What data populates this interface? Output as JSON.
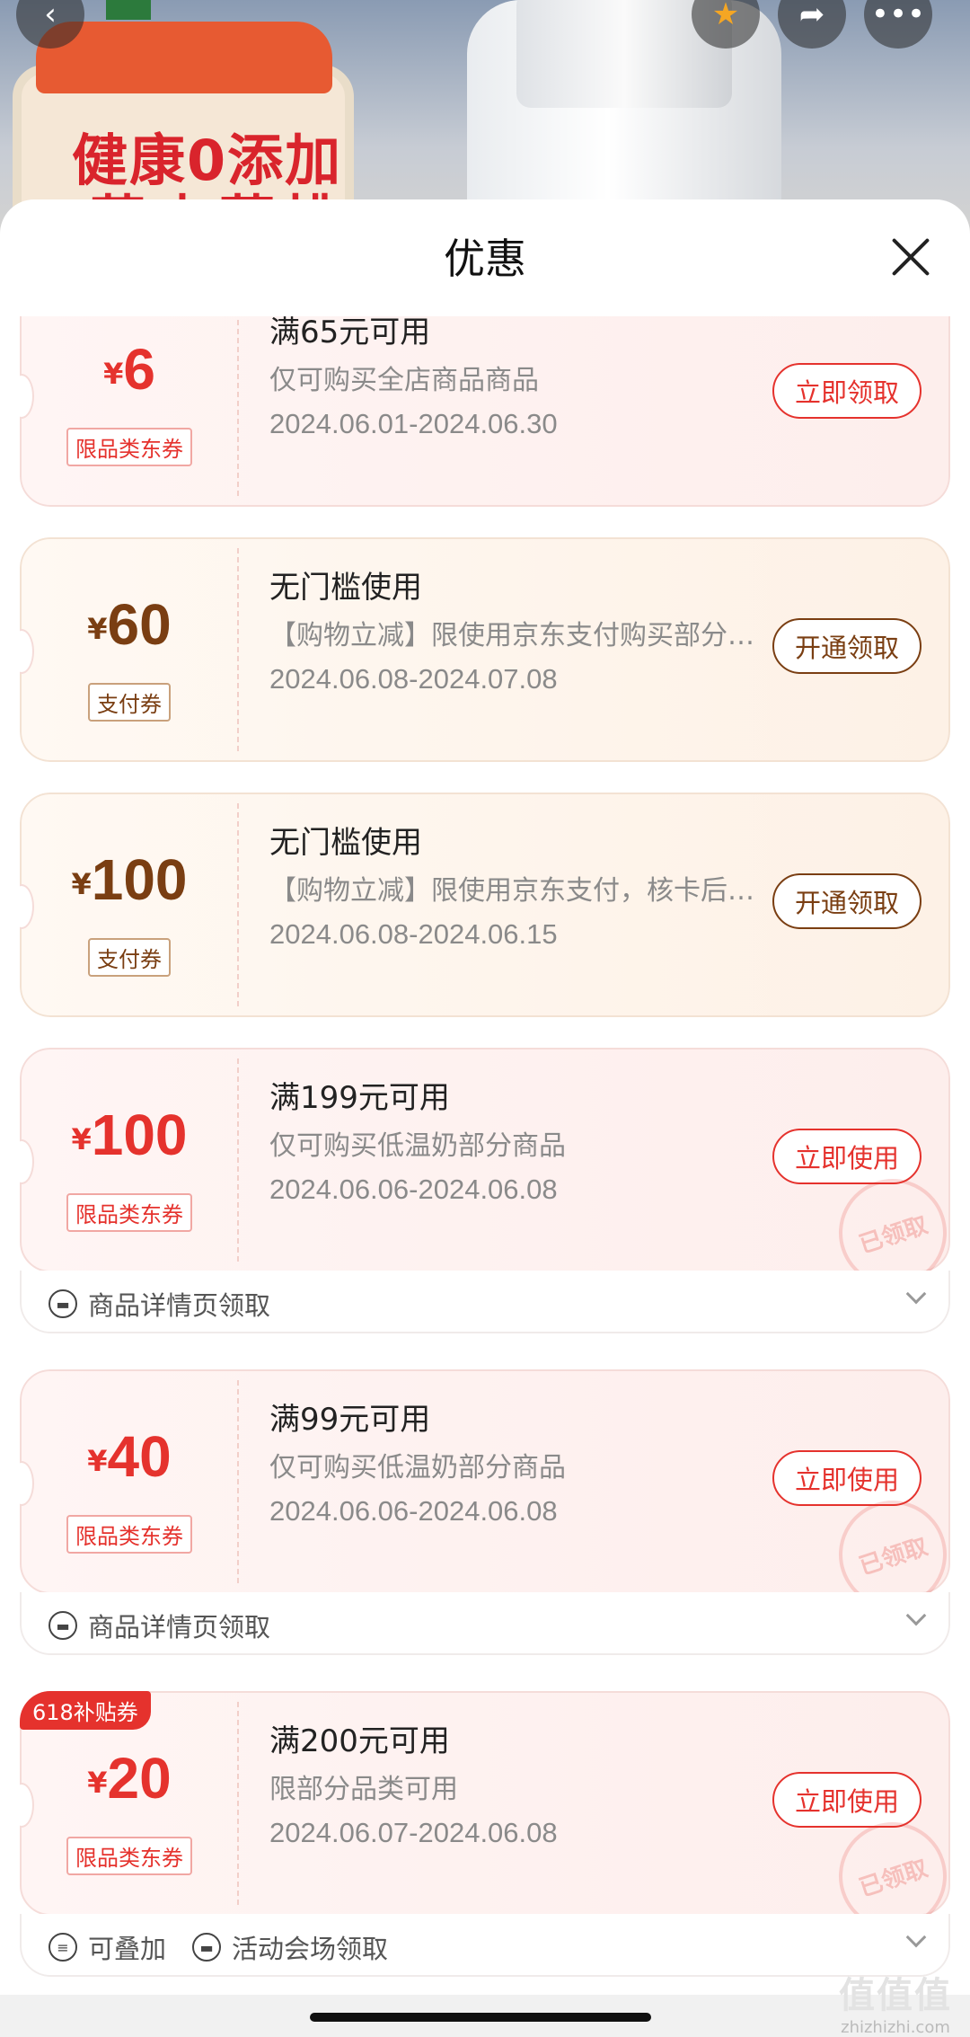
{
  "background": {
    "banner_line1": "健康0添加",
    "banner_line2": "草本菲桃"
  },
  "sheet": {
    "title": "优惠"
  },
  "coupons": [
    {
      "currency": "¥",
      "amount": "6",
      "tag": "限品类东券",
      "title": "满65元可用",
      "desc": "仅可购买全店商品商品",
      "date": "2024.06.01-2024.06.30",
      "button": "立即领取",
      "theme": "red"
    },
    {
      "currency": "¥",
      "amount": "60",
      "tag": "支付券",
      "title": "无门槛使用",
      "desc": "【购物立减】限使用京东支付购买部分商品",
      "date": "2024.06.08-2024.07.08",
      "button": "开通领取",
      "theme": "gold"
    },
    {
      "currency": "¥",
      "amount": "100",
      "tag": "支付券",
      "title": "无门槛使用",
      "desc": "【购物立减】限使用京东支付，核卡后可用",
      "date": "2024.06.08-2024.06.15",
      "button": "开通领取",
      "theme": "gold"
    },
    {
      "currency": "¥",
      "amount": "100",
      "tag": "限品类东券",
      "title": "满199元可用",
      "desc": "仅可购买低温奶部分商品",
      "date": "2024.06.06-2024.06.08",
      "button": "立即使用",
      "stamp": "已领取",
      "footer_source": "商品详情页领取",
      "theme": "red"
    },
    {
      "currency": "¥",
      "amount": "40",
      "tag": "限品类东券",
      "title": "满99元可用",
      "desc": "仅可购买低温奶部分商品",
      "date": "2024.06.06-2024.06.08",
      "button": "立即使用",
      "stamp": "已领取",
      "footer_source": "商品详情页领取",
      "theme": "red"
    },
    {
      "currency": "¥",
      "amount": "20",
      "tag": "限品类东券",
      "title": "满200元可用",
      "desc": "限部分品类可用",
      "date": "2024.06.07-2024.06.08",
      "button": "立即使用",
      "stamp": "已领取",
      "ribbon": "618补贴券",
      "footer_stack": "可叠加",
      "footer_source": "活动会场领取",
      "theme": "red"
    }
  ],
  "watermark": {
    "line1": "值值值",
    "line2": "zhizhizhi.com"
  },
  "icons": {
    "back": "back-arrow-icon",
    "favorite": "star-icon",
    "share": "share-icon",
    "more": "more-dots-icon",
    "close": "close-icon",
    "ticket": "ticket-icon",
    "stack": "stack-icon",
    "chevron": "chevron-down-icon"
  },
  "colors": {
    "accent_red": "#e5322d",
    "accent_gold": "#7a3e12"
  }
}
